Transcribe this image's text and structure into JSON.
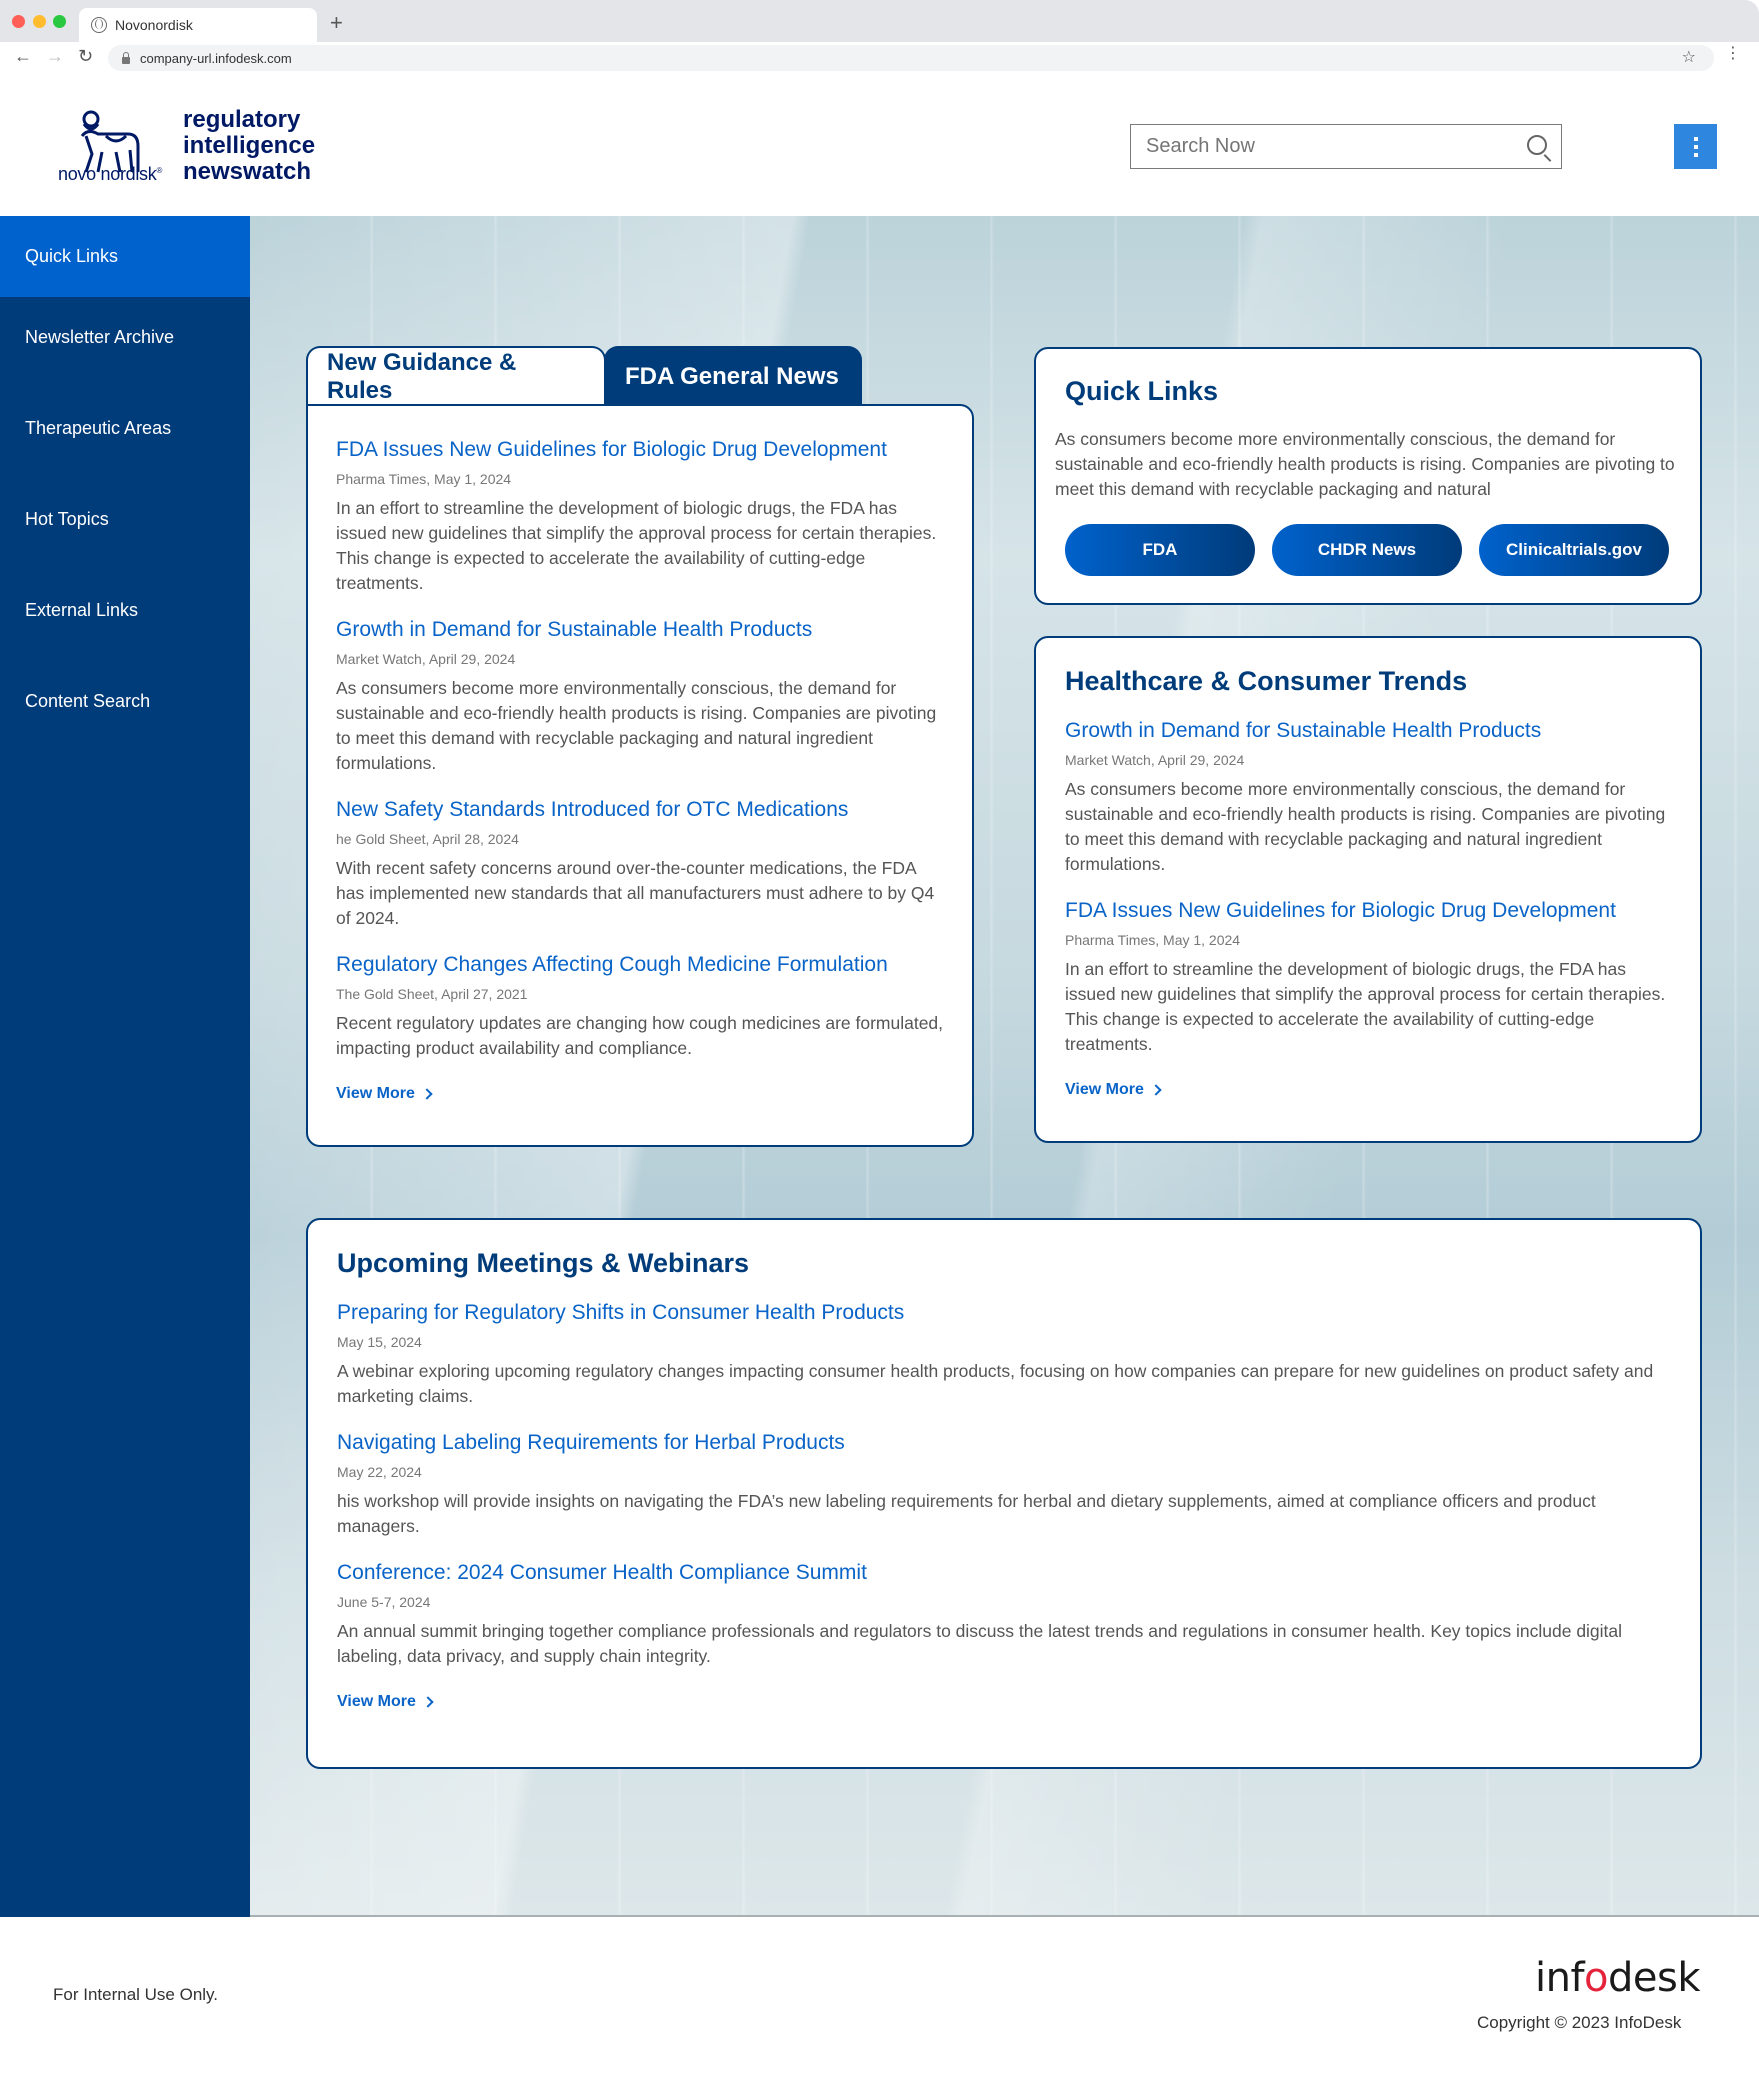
{
  "browser": {
    "tab_title": "Novonordisk",
    "url": "company-url.infodesk.com"
  },
  "header": {
    "logo_text": "novo nordisk",
    "title_lines": [
      "regulatory",
      "intelligence",
      "newswatch"
    ],
    "search_placeholder": "Search Now"
  },
  "sidebar": {
    "items": [
      {
        "label": "Quick Links",
        "active": true
      },
      {
        "label": "Newsletter Archive",
        "active": false
      },
      {
        "label": "Therapeutic Areas",
        "active": false
      },
      {
        "label": "Hot Topics",
        "active": false
      },
      {
        "label": "External Links",
        "active": false
      },
      {
        "label": "Content Search",
        "active": false
      }
    ]
  },
  "news_tabs": {
    "tabs": [
      {
        "label": "New Guidance & Rules",
        "active": false
      },
      {
        "label": "FDA General News",
        "active": true
      }
    ],
    "items": [
      {
        "title": "FDA Issues New Guidelines for Biologic Drug Development",
        "meta": "Pharma Times, May 1, 2024",
        "body": "In an effort to streamline the development of biologic drugs, the FDA has issued new guidelines that simplify the approval process for certain therapies. This change is expected to accelerate the availability of cutting-edge treatments."
      },
      {
        "title": "Growth in Demand for Sustainable Health Products",
        "meta": "Market Watch, April 29, 2024",
        "body": "As consumers become more environmentally conscious, the demand for sustainable and eco-friendly health products is rising. Companies are pivoting to meet this demand with recyclable packaging and natural ingredient formulations."
      },
      {
        "title": "New Safety Standards Introduced for OTC Medications",
        "meta": "he Gold Sheet, April 28, 2024",
        "body": "With recent safety concerns around over-the-counter medications, the FDA has implemented new standards that all manufacturers must adhere to by Q4 of 2024."
      },
      {
        "title": "Regulatory Changes Affecting Cough Medicine Formulation",
        "meta": "The Gold Sheet, April 27, 2021",
        "body": "Recent regulatory updates are changing how cough medicines are formulated, impacting product availability and compliance."
      }
    ],
    "view_more": "View More"
  },
  "quick_links": {
    "heading": "Quick Links",
    "text": "As consumers become more environmentally conscious, the demand for sustainable and eco-friendly health products is rising. Companies are pivoting to meet this demand with recyclable packaging and natural",
    "buttons": [
      "FDA",
      "CHDR News",
      "Clinicaltrials.gov"
    ]
  },
  "trends": {
    "heading": "Healthcare & Consumer Trends",
    "items": [
      {
        "title": "Growth in Demand for Sustainable Health Products",
        "meta": "Market Watch, April 29, 2024",
        "body": "As consumers become more environmentally conscious, the demand for sustainable and eco-friendly health products is rising. Companies are pivoting to meet this demand with recyclable packaging and natural ingredient formulations."
      },
      {
        "title": "FDA Issues New Guidelines for Biologic Drug Development",
        "meta": "Pharma Times, May 1, 2024",
        "body": "In an effort to streamline the development of biologic drugs, the FDA has issued new guidelines that simplify the approval process for certain therapies. This change is expected to accelerate the availability of cutting-edge treatments."
      }
    ],
    "view_more": "View More"
  },
  "meetings": {
    "heading": "Upcoming Meetings & Webinars",
    "items": [
      {
        "title": "Preparing for Regulatory Shifts in Consumer Health Products",
        "meta": "May 15, 2024",
        "body": "A webinar exploring upcoming regulatory changes impacting consumer health products, focusing on how companies can prepare for new guidelines on product safety and marketing claims."
      },
      {
        "title": "Navigating Labeling Requirements for Herbal Products",
        "meta": "May 22, 2024",
        "body": "his workshop will provide insights on navigating the FDA’s new labeling requirements for herbal and dietary supplements, aimed at compliance officers and product managers."
      },
      {
        "title": "Conference: 2024 Consumer Health Compliance Summit",
        "meta": "June 5-7, 2024",
        "body": "An annual summit bringing together compliance professionals and regulators to discuss the latest trends and regulations in consumer health. Key topics include digital labeling, data privacy, and supply chain integrity."
      }
    ],
    "view_more": "View More"
  },
  "footer": {
    "notice": "For Internal Use Only.",
    "brand_pre": "inf",
    "brand_o": "o",
    "brand_post": "desk",
    "copyright": "Copyright © 2023 InfoDesk"
  },
  "colors": {
    "navy": "#003b7a",
    "active_blue": "#0062cc",
    "link_blue": "#0a64c8",
    "menu_button": "#2e86de",
    "infodesk_red": "#e5243b"
  }
}
